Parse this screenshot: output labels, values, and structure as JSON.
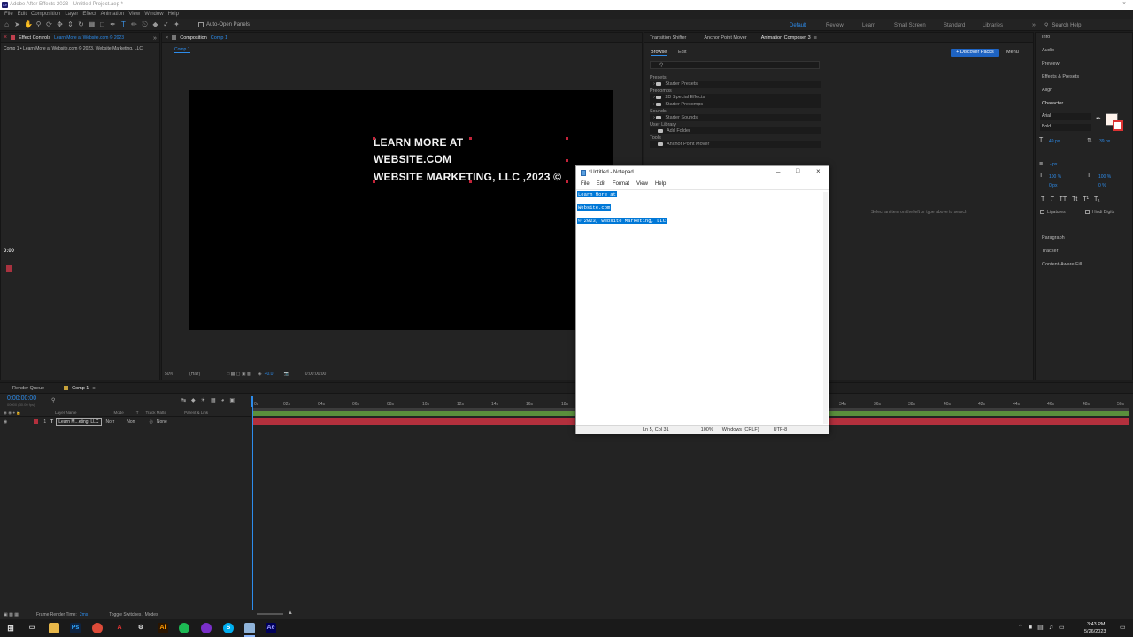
{
  "titlebar": {
    "title": "Adobe After Effects 2023 - Untitled Project.aep *",
    "app_badge": "Ae"
  },
  "menubar": [
    "File",
    "Edit",
    "Composition",
    "Layer",
    "Effect",
    "Animation",
    "View",
    "Window",
    "Help"
  ],
  "toolbar": {
    "auto_open": "Auto-Open Panels",
    "workspaces": [
      "Default",
      "Review",
      "Learn",
      "Small Screen",
      "Standard",
      "Libraries"
    ],
    "active_workspace": "Default",
    "search_help": "Search Help"
  },
  "effect_controls": {
    "tab_label": "Effect Controls",
    "tab_layer": "Learn More at  Website.com  © 2023",
    "header": "Comp 1 • Learn More at  Website.com  © 2023, Website Marketing, LLC"
  },
  "composition": {
    "tab_label": "Composition",
    "comp_name": "Comp 1",
    "flow_label": "Comp 1",
    "text_lines": [
      "LEARN MORE AT",
      "WEBSITE.COM",
      "WEBSITE MARKETING, LLC ,2023 ©"
    ],
    "zoom": "50%",
    "resolution": "(Half)",
    "exposure": "+0.0",
    "timecode": "0:00:00:00"
  },
  "left_time": "0:00",
  "animation_composer": {
    "tabs": [
      "Transition Shifter",
      "Anchor Point Mover",
      "Animation Composer 3"
    ],
    "subtabs": [
      "Browse",
      "Edit"
    ],
    "discover_button": "+ Discover Packs",
    "menu": "Menu",
    "sections": [
      {
        "title": "Presets",
        "items": [
          "Starter Presets"
        ]
      },
      {
        "title": "Precomps",
        "items": [
          "2D Special Effects",
          "Starter Precomps"
        ]
      },
      {
        "title": "Sounds",
        "items": [
          "Starter Sounds"
        ]
      },
      {
        "title": "User Library",
        "items": [
          "Add Folder"
        ]
      },
      {
        "title": "Tools",
        "items": [
          "Anchor Point Mover"
        ]
      }
    ],
    "empty_message": "Select an item on the left or type above to search"
  },
  "right_panel": {
    "items": [
      "Info",
      "Audio",
      "Preview",
      "Effects & Presets",
      "Align",
      "Character"
    ],
    "character": {
      "font": "Arial",
      "style": "Bold",
      "size": "49 px",
      "leading": "39 px",
      "tracking_unit": "- px",
      "vscale": "100 %",
      "hscale": "100 %",
      "baseline": "0 px",
      "tsume": "0 %",
      "ligatures": "Ligatures",
      "hindi_digits": "Hindi Digits"
    },
    "bottom_items": [
      "Paragraph",
      "Tracker",
      "Content-Aware Fill"
    ]
  },
  "timeline": {
    "tabs": [
      "Render Queue",
      "Comp 1"
    ],
    "timecode": "0:00:00:00",
    "timecode_sub": "00000 (30.00 fps)",
    "columns": [
      "Layer Name",
      "Mode",
      "T",
      "Track Matte",
      "Parent & Link"
    ],
    "layer": {
      "index": "1",
      "name": "Learn M...eting, LLC",
      "mode": "Norr",
      "matte": "Non",
      "parent": "None"
    },
    "ticks": [
      "0s",
      "02s",
      "04s",
      "06s",
      "08s",
      "10s",
      "12s",
      "14s",
      "16s",
      "18s",
      "34s",
      "36s",
      "38s",
      "40s",
      "42s",
      "44s",
      "46s",
      "48s",
      "50s"
    ],
    "frame_render": "Frame Render Time:",
    "frame_render_value": "2ms",
    "toggle": "Toggle Switches / Modes"
  },
  "notepad": {
    "title": "*Untitled - Notepad",
    "menu": [
      "File",
      "Edit",
      "Format",
      "View",
      "Help"
    ],
    "lines": [
      "Learn More at",
      "Website.com",
      "© 2023, Website Marketing, LLC"
    ],
    "status": {
      "position": "Ln 5, Col 31",
      "zoom": "100%",
      "eol": "Windows (CRLF)",
      "encoding": "UTF-8"
    }
  },
  "taskbar": {
    "time": "3:43 PM",
    "date": "5/26/2023",
    "apps": [
      "Ps",
      "Ai",
      "Ae"
    ]
  },
  "colors": {
    "accent": "#2d8ceb",
    "layer_bar": "#b3303d",
    "selection": "#0078d7"
  }
}
